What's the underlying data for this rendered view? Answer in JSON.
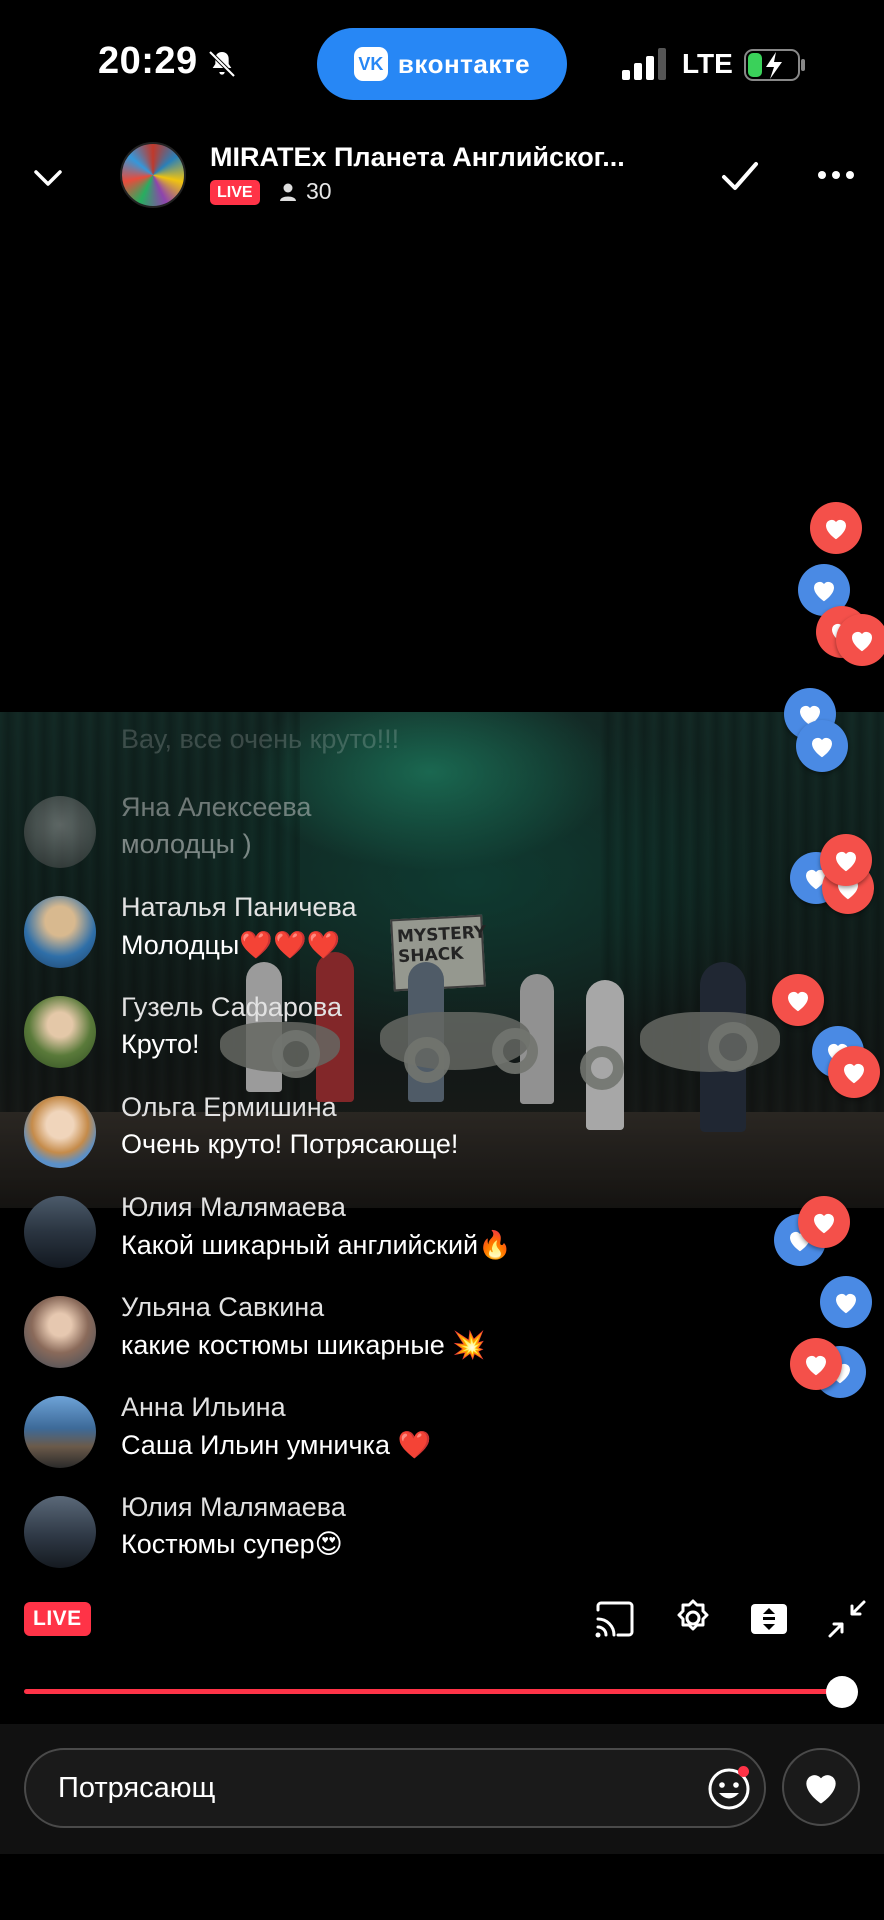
{
  "status_bar": {
    "time": "20:29",
    "app_pill": "вконтакте",
    "app_logo": "vk",
    "network": "LTE",
    "icons": [
      "bell-slash-icon",
      "signal-icon",
      "battery-charging-icon"
    ]
  },
  "header": {
    "title": "MIRATEx Планета Английског...",
    "live_label": "LIVE",
    "viewers": "30",
    "icons": [
      "chevron-down-icon",
      "person-icon",
      "checkmark-icon",
      "more-icon"
    ]
  },
  "video": {
    "sign_text": "MYSTERY SHACK"
  },
  "comments": {
    "ghost": "Вау, все очень круто!!!",
    "items": [
      {
        "name": "Яна Алексеева",
        "text": "молодцы )"
      },
      {
        "name": "Наталья Паничева",
        "text": "Молодцы❤️❤️❤️"
      },
      {
        "name": "Гузель Сафарова",
        "text": "Круто!"
      },
      {
        "name": "Ольга Ермишина",
        "text": "Очень круто! Потрясающе!"
      },
      {
        "name": "Юлия Малямаева",
        "text": "Какой шикарный английский🔥"
      },
      {
        "name": "Ульяна Савкина",
        "text": "какие костюмы шикарные 💥"
      },
      {
        "name": "Анна Ильина",
        "text": "Саша Ильин умничка ❤️"
      },
      {
        "name": "Юлия Малямаева",
        "text": "Костюмы супер😍"
      }
    ]
  },
  "controls": {
    "live_label": "LIVE",
    "icons": [
      "cast-icon",
      "settings-icon",
      "pip-icon",
      "collapse-icon"
    ],
    "progress": 1.0
  },
  "composer": {
    "input_value": "Потрясающ",
    "icons": [
      "emoji-icon",
      "heart-icon"
    ]
  },
  "colors": {
    "live_red": "#ff3347",
    "vk_blue": "#2787f5",
    "heart_red": "#f4504a",
    "heart_blue": "#4a8ae4"
  }
}
